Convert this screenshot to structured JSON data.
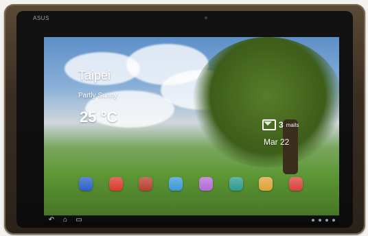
{
  "device": {
    "brand": "ASUS"
  },
  "widgets": {
    "weather": {
      "city": "Taipei",
      "condition": "Partly Sunny",
      "temperature": "25 °C"
    },
    "mail": {
      "count": "3",
      "label": "mails"
    },
    "date": "Mar 22"
  },
  "dock": {
    "apps": [
      {
        "icon": "globe-icon",
        "color": "#2b62c7"
      },
      {
        "icon": "youtube-icon",
        "color": "#d83a2d"
      },
      {
        "icon": "books-icon",
        "color": "#b6412c"
      },
      {
        "icon": "music-icon",
        "color": "#3a9ad8"
      },
      {
        "icon": "gallery-icon",
        "color": "#b46bd4"
      },
      {
        "icon": "market-icon",
        "color": "#2c9b8e"
      },
      {
        "icon": "mail-app-icon",
        "color": "#e0a23a"
      },
      {
        "icon": "gmail-icon",
        "color": "#d9433b"
      }
    ]
  },
  "navbar": {
    "left": [
      {
        "icon": "back-icon",
        "glyph": "↶"
      },
      {
        "icon": "home-icon",
        "glyph": "⌂"
      },
      {
        "icon": "recent-apps-icon",
        "glyph": "▭"
      }
    ]
  }
}
